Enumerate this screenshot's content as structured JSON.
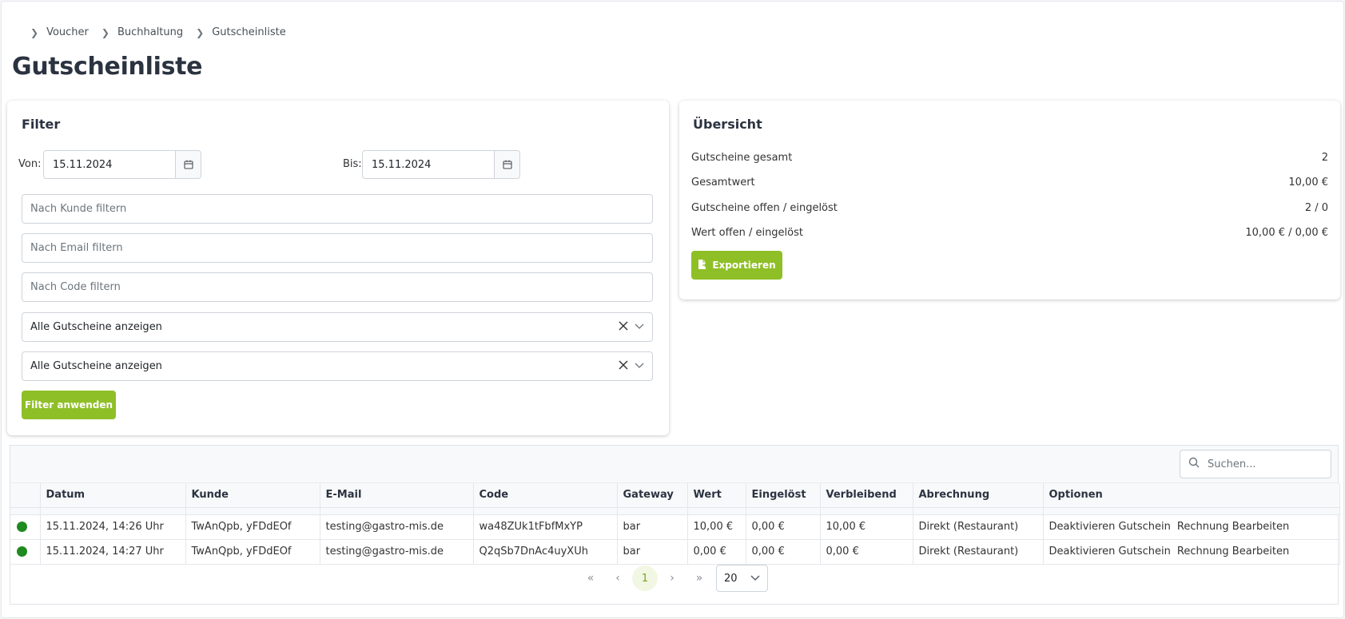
{
  "breadcrumb": [
    "Voucher",
    "Buchhaltung",
    "Gutscheinliste"
  ],
  "page_title": "Gutscheinliste",
  "filter": {
    "title": "Filter",
    "from_label": "Von:",
    "from_value": "15.11.2024",
    "to_label": "Bis:",
    "to_value": "15.11.2024",
    "customer_placeholder": "Nach Kunde filtern",
    "email_placeholder": "Nach Email filtern",
    "code_placeholder": "Nach Code filtern",
    "select1_value": "Alle Gutscheine anzeigen",
    "select2_value": "Alle Gutscheine anzeigen",
    "apply_label": "Filter anwenden"
  },
  "overview": {
    "title": "Übersicht",
    "rows": [
      {
        "label": "Gutscheine gesamt",
        "value": "2"
      },
      {
        "label": "Gesamtwert",
        "value": "10,00 €"
      },
      {
        "label": "Gutscheine offen / eingelöst",
        "value": "2 / 0"
      },
      {
        "label": "Wert offen / eingelöst",
        "value": "10,00 € / 0,00 €"
      }
    ],
    "export_label": "Exportieren"
  },
  "table": {
    "search_placeholder": "Suchen...",
    "columns": [
      "",
      "Datum",
      "Kunde",
      "E-Mail",
      "Code",
      "Gateway",
      "Wert",
      "Eingelöst",
      "Verbleibend",
      "Abrechnung",
      "Optionen"
    ],
    "rows": [
      {
        "status_color": "#1f8a1f",
        "datum": "15.11.2024, 14:26 Uhr",
        "kunde": "TwAnQpb, yFDdEOf",
        "email": "testing@gastro-mis.de",
        "code": "wa48ZUk1tFbfMxYP",
        "gateway": "bar",
        "wert": "10,00 €",
        "eingeloest": "0,00 €",
        "verbleibend": "10,00 €",
        "abrechnung": "Direkt (Restaurant)",
        "opt1": "Deaktivieren Gutschein",
        "opt2": "Rechnung Bearbeiten"
      },
      {
        "status_color": "#1f8a1f",
        "datum": "15.11.2024, 14:27 Uhr",
        "kunde": "TwAnQpb, yFDdEOf",
        "email": "testing@gastro-mis.de",
        "code": "Q2qSb7DnAc4uyXUh",
        "gateway": "bar",
        "wert": "0,00 €",
        "eingeloest": "0,00 €",
        "verbleibend": "0,00 €",
        "abrechnung": "Direkt (Restaurant)",
        "opt1": "Deaktivieren Gutschein",
        "opt2": "Rechnung Bearbeiten"
      }
    ]
  },
  "pagination": {
    "first": "«",
    "prev": "‹",
    "current": "1",
    "next": "›",
    "last": "»",
    "per_page": "20"
  },
  "colors": {
    "accent": "#8fbf27",
    "status_active": "#1f8a1f"
  }
}
